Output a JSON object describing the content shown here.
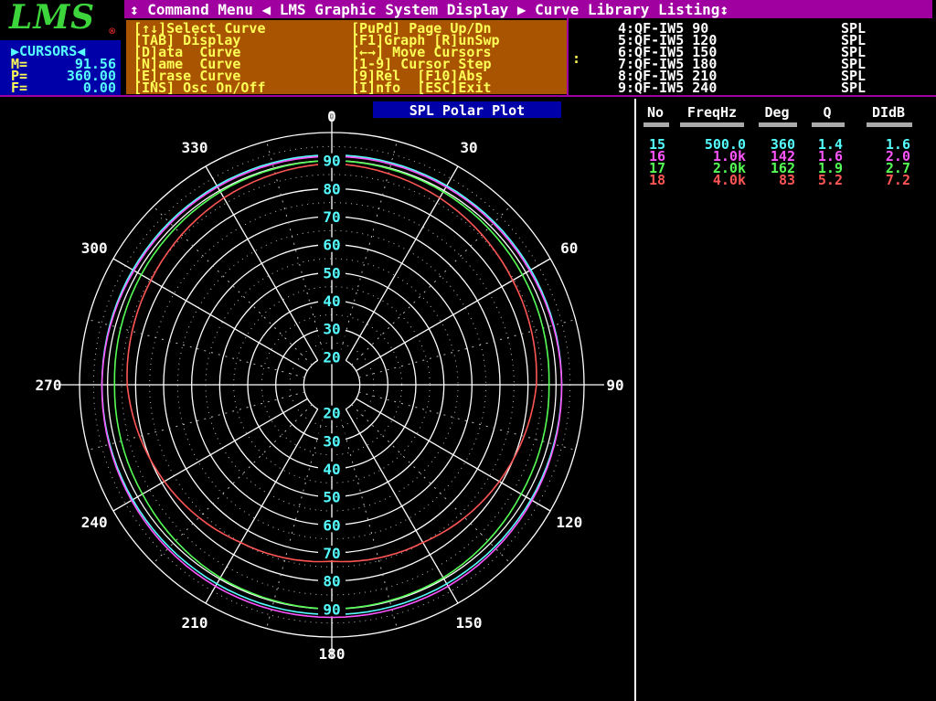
{
  "logo": {
    "text": "LMS",
    "mark": "®"
  },
  "cursors": {
    "title": "▶CURSORS◀",
    "rows": [
      {
        "key": "M=",
        "value": "91.56"
      },
      {
        "key": "P=",
        "value": "360.00"
      },
      {
        "key": "F=",
        "value": "0.00"
      }
    ]
  },
  "titlebar": {
    "text": "↕ Command Menu ◀ LMS Graphic System Display ▶ Curve Library Listing↕"
  },
  "command_menu": {
    "left": [
      "[↑↓]Select Curve",
      "[TAB] Display",
      "[D]ata  Curve",
      "[N]ame  Curve",
      "[E]rase Curve",
      "[INS] Osc On/Off"
    ],
    "right": [
      "[PuPd] Page Up/Dn",
      "[F1]Graph [R]unSwp",
      "[←→] Move Cursors",
      "[1-9] Cursor Step",
      "[9]Rel  [F10]Abs",
      "[I]nfo  [ESC]Exit"
    ]
  },
  "library": {
    "colon": ":",
    "items": [
      {
        "id": "4:QF-IW5 90",
        "type": "SPL"
      },
      {
        "id": "5:QF-IW5 120",
        "type": "SPL"
      },
      {
        "id": "6:QF-IW5 150",
        "type": "SPL"
      },
      {
        "id": "7:QF-IW5 180",
        "type": "SPL"
      },
      {
        "id": "8:QF-IW5 210",
        "type": "SPL"
      },
      {
        "id": "9:QF-IW5 240",
        "type": "SPL"
      }
    ]
  },
  "table": {
    "headers": [
      "No",
      "FreqHz",
      "Deg",
      "Q",
      "DIdB"
    ],
    "rows": [
      {
        "no": "15",
        "freq": "500.0",
        "deg": "360",
        "q": "1.4",
        "di": "1.6",
        "color": "#55ffff"
      },
      {
        "no": "16",
        "freq": "1.0k",
        "deg": "142",
        "q": "1.6",
        "di": "2.0",
        "color": "#ff55ff"
      },
      {
        "no": "17",
        "freq": "2.0k",
        "deg": "162",
        "q": "1.9",
        "di": "2.7",
        "color": "#55ff55"
      },
      {
        "no": "18",
        "freq": "4.0k",
        "deg": "83",
        "q": "5.2",
        "di": "7.2",
        "color": "#ff5555"
      }
    ]
  },
  "chart_data": {
    "type": "polar",
    "title": "SPL Polar Plot",
    "radial_ticks": [
      "20",
      "30",
      "40",
      "50",
      "60",
      "70",
      "80",
      "90"
    ],
    "radial_range": [
      10,
      100
    ],
    "angle_labels": [
      "0",
      "30",
      "60",
      "90",
      "120",
      "150",
      "180",
      "210",
      "240",
      "270",
      "300",
      "330"
    ],
    "series": [
      {
        "id": "15",
        "color": "#55ffff",
        "angles": [
          0,
          30,
          60,
          90,
          120,
          150,
          180,
          210,
          240,
          270,
          300,
          330
        ],
        "values": [
          92,
          92,
          92,
          92,
          92,
          92,
          92,
          92,
          92,
          92,
          92,
          92
        ]
      },
      {
        "id": "16",
        "color": "#ff55ff",
        "angles": [
          0,
          30,
          60,
          90,
          120,
          150,
          180,
          210,
          240,
          270,
          300,
          330
        ],
        "values": [
          91.5,
          91.5,
          91.5,
          92,
          92.5,
          93,
          93,
          93,
          92.5,
          92,
          91.5,
          91.5
        ]
      },
      {
        "id": "17",
        "color": "#55ff55",
        "angles": [
          0,
          30,
          60,
          90,
          120,
          150,
          180,
          210,
          240,
          270,
          300,
          330
        ],
        "values": [
          90,
          89.5,
          88.5,
          87.5,
          88,
          89.5,
          90,
          89.5,
          88,
          87.5,
          88.5,
          89.5
        ]
      },
      {
        "id": "18",
        "color": "#ff5555",
        "angles": [
          0,
          30,
          60,
          90,
          120,
          150,
          180,
          210,
          240,
          270,
          300,
          330
        ],
        "values": [
          89,
          87,
          84.5,
          83,
          79,
          75,
          73,
          75,
          79,
          83,
          84.5,
          87
        ]
      }
    ]
  }
}
